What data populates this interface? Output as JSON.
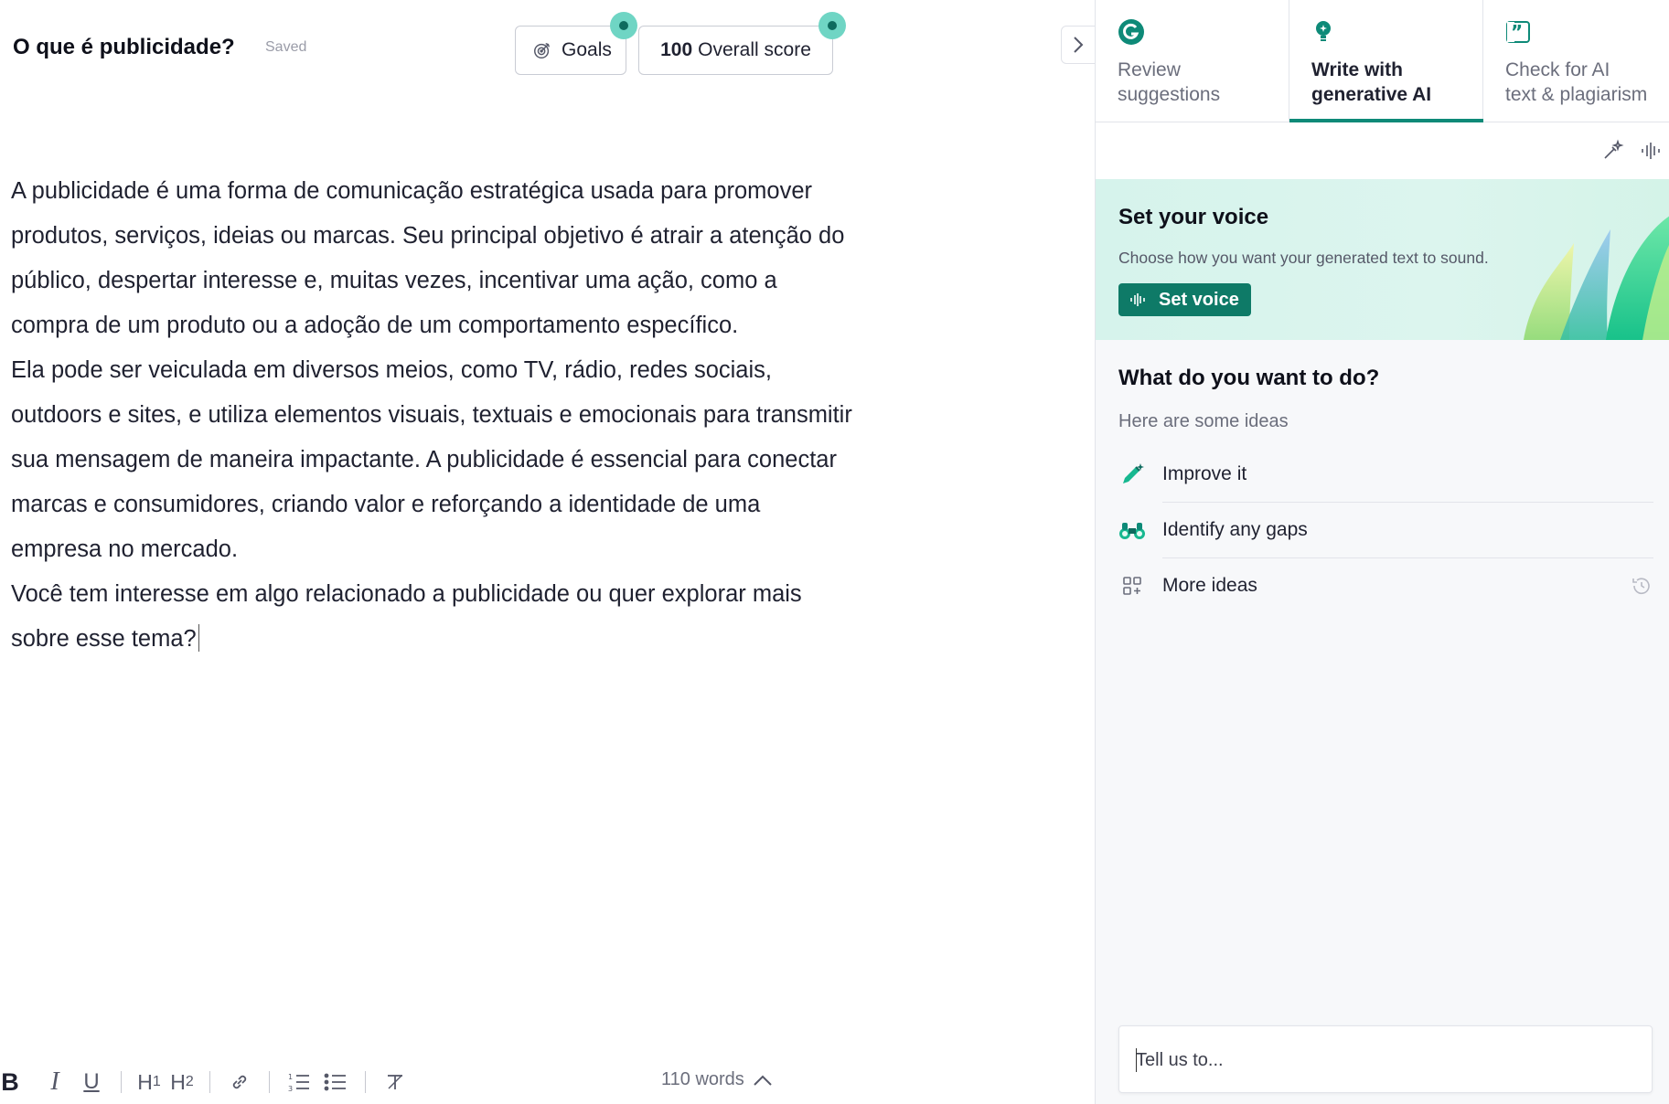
{
  "document": {
    "title": "O que é publicidade?",
    "save_status": "Saved",
    "paragraphs": [
      "A publicidade é uma forma de comunicação estratégica usada para promover produtos, serviços, ideias ou marcas. Seu principal objetivo é atrair a atenção do público, despertar interesse e, muitas vezes, incentivar uma ação, como a compra de um produto ou a adoção de um comportamento específico.",
      "Ela pode ser veiculada em diversos meios, como TV, rádio, redes sociais, outdoors e sites, e utiliza elementos visuais, textuais e emocionais para transmitir sua mensagem de maneira impactante. A publicidade é essencial para conectar marcas e consumidores, criando valor e reforçando a identidade de uma empresa no mercado.",
      "Você tem interesse em algo relacionado a publicidade ou quer explorar mais sobre esse tema?"
    ]
  },
  "header": {
    "goals_label": "Goals",
    "score_value": "100",
    "score_label": "Overall score"
  },
  "toolbar": {
    "bold": "B",
    "italic": "I",
    "underline": "U",
    "h1": "H",
    "h1_sub": "1",
    "h2": "H",
    "h2_sub": "2",
    "word_count": "110 words"
  },
  "panel": {
    "tabs": [
      {
        "label": "Review\nsuggestions",
        "icon": "grammarly-g-icon",
        "active": false
      },
      {
        "label": "Write with\ngenerative AI",
        "icon": "lightbulb-icon",
        "active": true
      },
      {
        "label": "Check for AI\ntext & plagiarism",
        "icon": "quote-icon",
        "active": false
      }
    ],
    "voice": {
      "title": "Set your voice",
      "subtitle": "Choose how you want your generated text to sound.",
      "button_label": "Set voice"
    },
    "todo": {
      "title": "What do you want to do?",
      "subtitle": "Here are some ideas",
      "ideas": [
        {
          "label": "Improve it",
          "icon": "pencil-sparkle-icon"
        },
        {
          "label": "Identify any gaps",
          "icon": "binoculars-icon"
        },
        {
          "label": "More ideas",
          "icon": "grid-plus-icon"
        }
      ]
    },
    "prompt": {
      "placeholder": "Tell us to..."
    }
  },
  "colors": {
    "accent": "#0e8a78",
    "button": "#0e7a67",
    "dot": "#6fd5c4",
    "voice_bg": "#d6f3ec"
  }
}
